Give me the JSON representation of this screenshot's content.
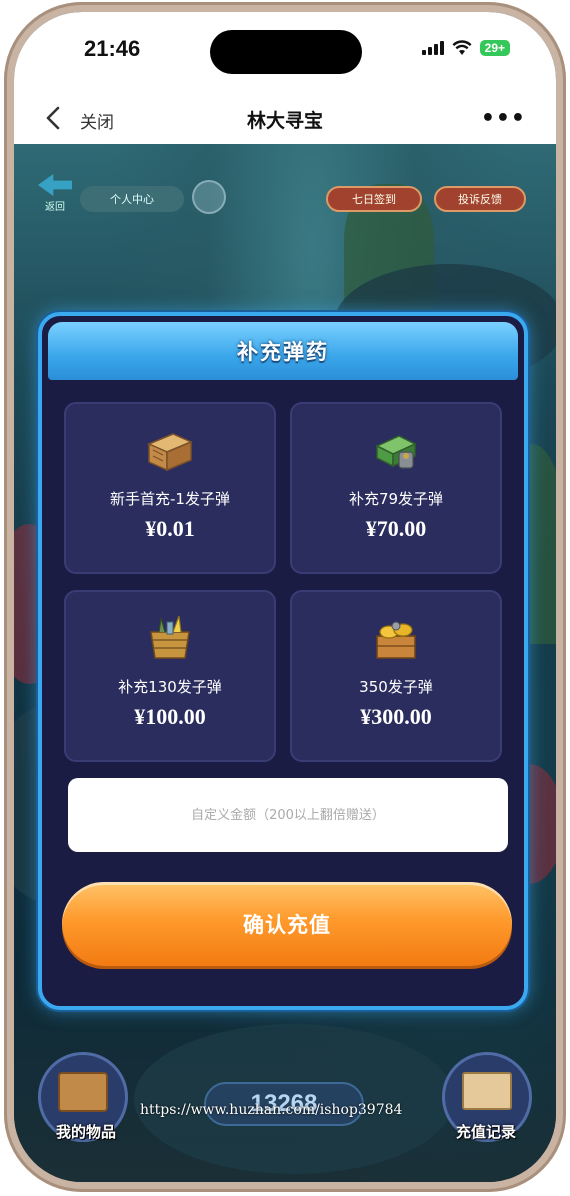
{
  "status_bar": {
    "time": "21:46",
    "battery": "29+"
  },
  "navbar": {
    "close_label": "关闭",
    "title": "林大寻宝",
    "more": "•••"
  },
  "game": {
    "back_label": "返回",
    "user_center": "个人中心",
    "top_button_1": "七日签到",
    "top_button_2": "投诉反馈",
    "score": "13268",
    "my_items": "我的物品",
    "recharge_record": "充值记录",
    "watermark": "https://www.huzhan.com/ishop39784"
  },
  "modal": {
    "title": "补充弹药",
    "packages": [
      {
        "name": "新手首充-1发子弹",
        "price": "¥0.01",
        "icon": "crate-icon"
      },
      {
        "name": "补充79发子弹",
        "price": "¥70.00",
        "icon": "cash-stack-icon"
      },
      {
        "name": "补充130发子弹",
        "price": "¥100.00",
        "icon": "basket-icon"
      },
      {
        "name": "350发子弹",
        "price": "¥300.00",
        "icon": "treasure-chest-icon"
      }
    ],
    "custom_amount_placeholder": "自定义金额（200以上翻倍赠送）",
    "confirm_label": "确认充值"
  },
  "colors": {
    "modal_border": "#3aa9f0",
    "modal_bg": "#1b1c44",
    "card_bg": "#2b2d5e",
    "confirm_orange": "#ff9a2c"
  }
}
